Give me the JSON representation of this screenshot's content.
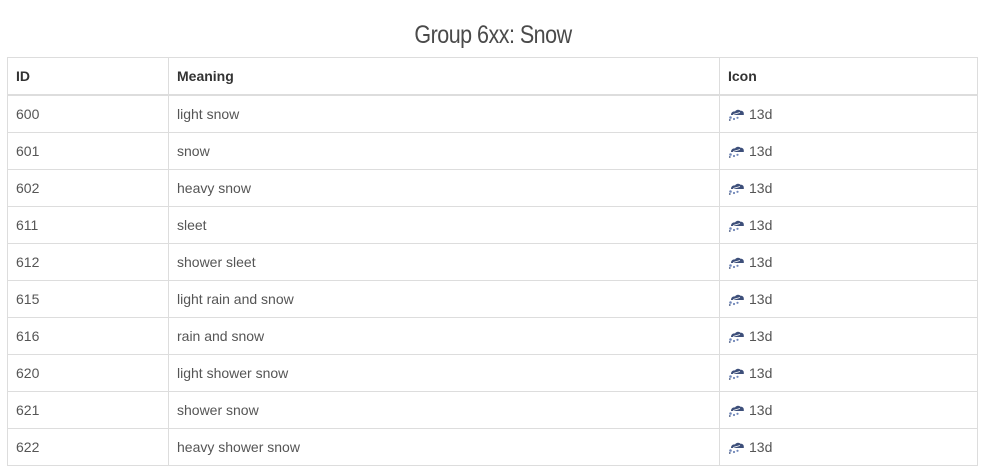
{
  "title": "Group 6xx: Snow",
  "table": {
    "headers": {
      "id": "ID",
      "meaning": "Meaning",
      "icon": "Icon"
    },
    "rows": [
      {
        "id": "600",
        "meaning": "light snow",
        "icon_label": "13d",
        "icon": "snow-icon"
      },
      {
        "id": "601",
        "meaning": "snow",
        "icon_label": "13d",
        "icon": "snow-icon"
      },
      {
        "id": "602",
        "meaning": "heavy snow",
        "icon_label": "13d",
        "icon": "snow-icon"
      },
      {
        "id": "611",
        "meaning": "sleet",
        "icon_label": "13d",
        "icon": "snow-icon"
      },
      {
        "id": "612",
        "meaning": "shower sleet",
        "icon_label": "13d",
        "icon": "snow-icon"
      },
      {
        "id": "615",
        "meaning": "light rain and snow",
        "icon_label": "13d",
        "icon": "snow-icon"
      },
      {
        "id": "616",
        "meaning": "rain and snow",
        "icon_label": "13d",
        "icon": "snow-icon"
      },
      {
        "id": "620",
        "meaning": "light shower snow",
        "icon_label": "13d",
        "icon": "snow-icon"
      },
      {
        "id": "621",
        "meaning": "shower snow",
        "icon_label": "13d",
        "icon": "snow-icon"
      },
      {
        "id": "622",
        "meaning": "heavy shower snow",
        "icon_label": "13d",
        "icon": "snow-icon"
      }
    ]
  },
  "colors": {
    "border": "#dddddd",
    "text": "#555555",
    "icon_cloud": "#3d4f7a",
    "icon_flake": "#6f86b8"
  }
}
